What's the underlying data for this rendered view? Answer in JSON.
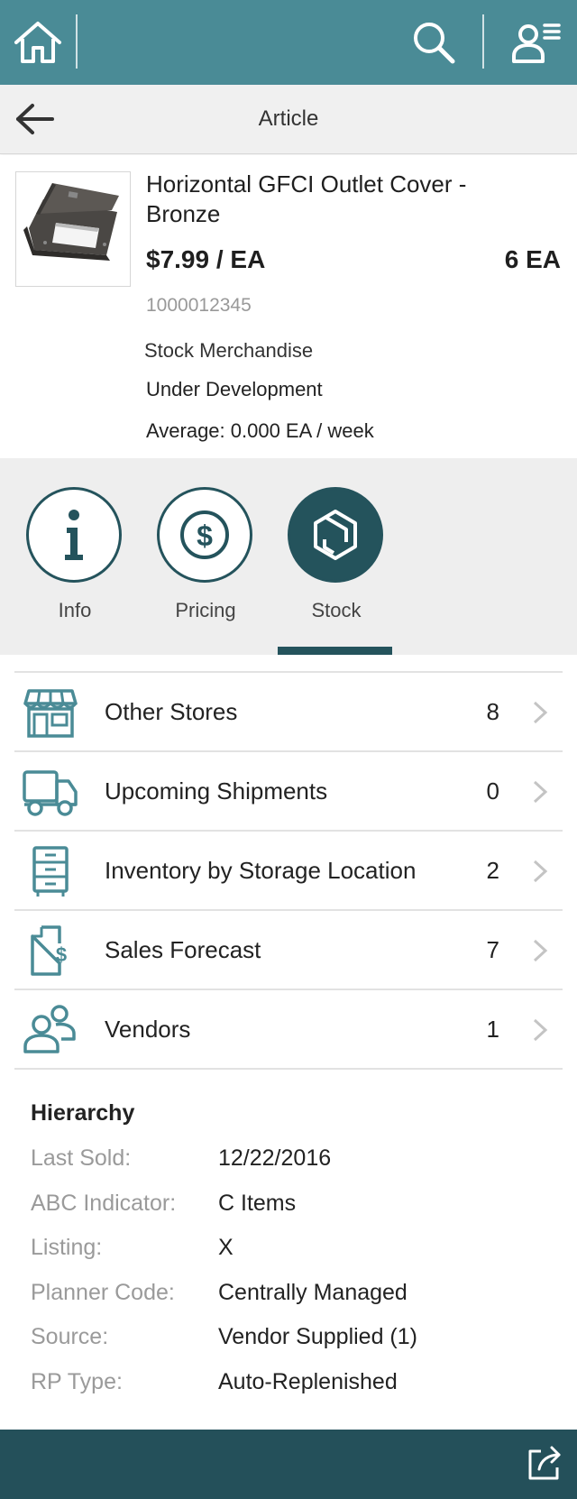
{
  "topbar": {
    "home_icon": "home-icon",
    "search_icon": "search-icon",
    "user_icon": "user-menu-icon",
    "color": "#4a8b96"
  },
  "navbar": {
    "back_icon": "back-arrow-icon",
    "title": "Article"
  },
  "article": {
    "name": "Horizontal GFCI Outlet Cover - Bronze",
    "price": "$7.99 / EA",
    "quantity": "6 EA",
    "number": "1000012345",
    "material_type": "Stock Merchandise",
    "status": "Under Development",
    "average": "Average: 0.000 EA / week"
  },
  "tabs": [
    {
      "label": "Info",
      "icon": "info-icon",
      "active": false
    },
    {
      "label": "Pricing",
      "icon": "dollar-icon",
      "active": false
    },
    {
      "label": "Stock",
      "icon": "box-icon",
      "active": true
    }
  ],
  "stock_list": [
    {
      "label": "Other Stores",
      "count": "8",
      "icon": "store-icon"
    },
    {
      "label": "Upcoming Shipments",
      "count": "0",
      "icon": "truck-icon"
    },
    {
      "label": "Inventory by Storage Location",
      "count": "2",
      "icon": "cabinet-icon"
    },
    {
      "label": "Sales Forecast",
      "count": "7",
      "icon": "forecast-document-icon"
    },
    {
      "label": "Vendors",
      "count": "1",
      "icon": "people-icon"
    }
  ],
  "hierarchy": {
    "title": "Hierarchy",
    "rows": [
      {
        "key": "Last Sold:",
        "value": "12/22/2016"
      },
      {
        "key": "ABC Indicator:",
        "value": "C Items"
      },
      {
        "key": "Listing:",
        "value": "X"
      },
      {
        "key": "Planner Code:",
        "value": "Centrally Managed"
      },
      {
        "key": "Source:",
        "value": "Vendor Supplied (1)"
      },
      {
        "key": "RP Type:",
        "value": "Auto-Replenished"
      }
    ]
  },
  "footer": {
    "share_icon": "share-icon",
    "color": "#24505a"
  },
  "colors": {
    "accent": "#24535c",
    "header": "#4a8b96",
    "icon_teal": "#4a8b96"
  }
}
